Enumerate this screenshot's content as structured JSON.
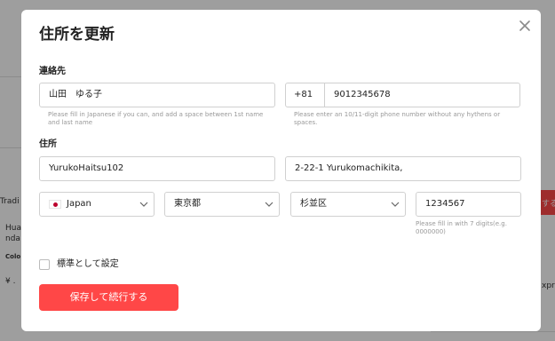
{
  "background": {
    "left_text": [
      "Tradi",
      "Hua",
      "nda",
      "Colo",
      "¥ ."
    ],
    "right_text": [
      "する",
      "xpr"
    ]
  },
  "modal": {
    "title": "住所を更新",
    "close_icon": "close-icon",
    "contact": {
      "section_label": "連絡先",
      "name_value": "山田　ゆる子",
      "name_helper": "Please fill in Japanese if you can, and add a space between 1st name and last name",
      "phone_prefix": "+81",
      "phone_value": "9012345678",
      "phone_helper": "Please enter an 10/11-digit phone number without any hythens or spaces."
    },
    "address": {
      "section_label": "住所",
      "line1_value": "YurukoHaitsu102",
      "line2_value": "2-22-1 Yurukomachikita,",
      "country_value": "Japan",
      "prefecture_value": "東京都",
      "city_value": "杉並区",
      "postal_value": "1234567",
      "postal_helper": "Please fill in with 7 digits(e.g. 0000000)"
    },
    "default_label": "標準として設定",
    "save_label": "保存して続行する"
  },
  "colors": {
    "accent": "#ff4747",
    "flag_red": "#bc002d"
  }
}
